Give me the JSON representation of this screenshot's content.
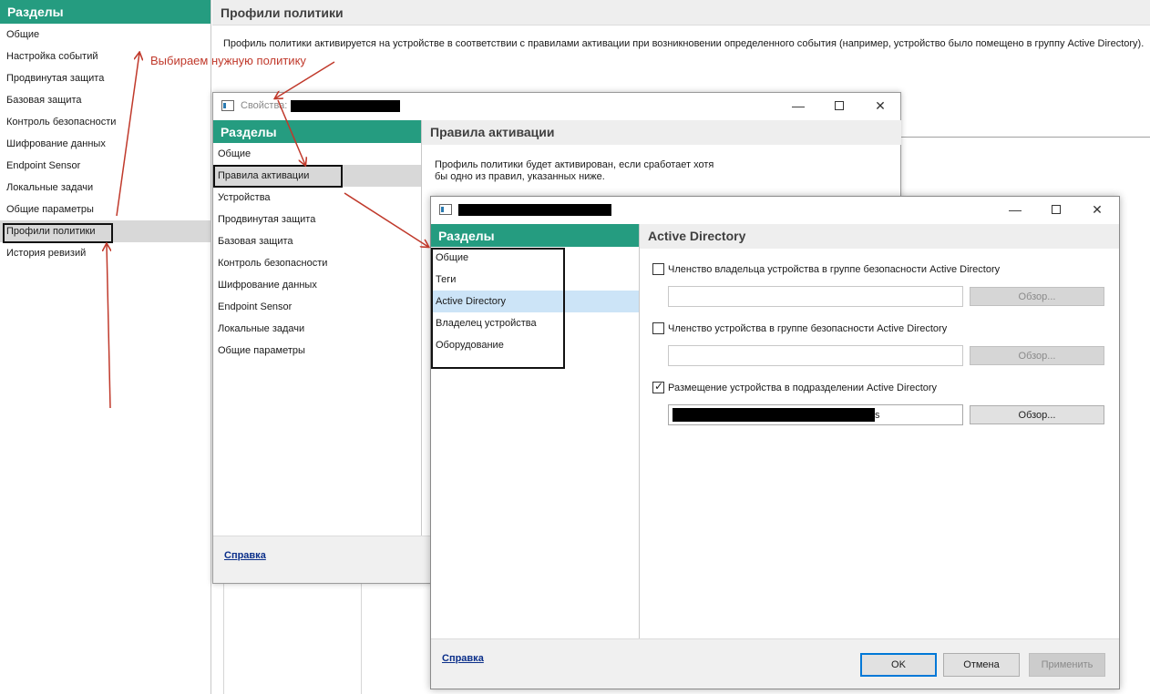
{
  "background": {
    "sidebar": {
      "header": "Разделы",
      "items": [
        "Общие",
        "Настройка событий",
        "Продвинутая защита",
        "Базовая защита",
        "Контроль безопасности",
        "Шифрование данных",
        "Endpoint Sensor",
        "Локальные задачи",
        "Общие параметры",
        "Профили политики",
        "История ревизий"
      ],
      "selected": "Профили политики"
    },
    "main": {
      "title": "Профили политики",
      "description": "Профиль политики активируется на устройстве в соответствии с правилами активации при возникновении определенного события (например, устройство было помещено в группу Active Directory)."
    }
  },
  "dialog1": {
    "title_prefix": "Свойства:",
    "sidebar": {
      "header": "Разделы",
      "items": [
        "Общие",
        "Правила активации",
        "Устройства",
        "Продвинутая защита",
        "Базовая защита",
        "Контроль безопасности",
        "Шифрование данных",
        "Endpoint Sensor",
        "Локальные задачи",
        "Общие параметры"
      ],
      "selected": "Правила активации"
    },
    "content": {
      "title": "Правила активации",
      "description": "Профиль политики будет активирован, если сработает хотя бы одно из правил, указанных ниже."
    },
    "footer": {
      "help": "Справка"
    }
  },
  "dialog2": {
    "sidebar": {
      "header": "Разделы",
      "items": [
        "Общие",
        "Теги",
        "Active Directory",
        "Владелец устройства",
        "Оборудование"
      ],
      "selected": "Active Directory"
    },
    "content": {
      "title": "Active Directory",
      "rules": [
        {
          "label": "Членство владельца устройства в группе безопасности Active Directory",
          "checked": false,
          "value": "",
          "browse": "Обзор...",
          "enabled": false
        },
        {
          "label": "Членство устройства в группе безопасности Active Directory",
          "checked": false,
          "value": "",
          "browse": "Обзор...",
          "enabled": false
        },
        {
          "label": "Размещение устройства в подразделении Active Directory",
          "checked": true,
          "value": "s",
          "browse": "Обзор...",
          "enabled": true
        }
      ]
    },
    "footer": {
      "help": "Справка",
      "ok": "OK",
      "cancel": "Отмена",
      "apply": "Применить"
    }
  },
  "annotation": {
    "text": "Выбираем нужную политику",
    "color": "#c0392b"
  },
  "colors": {
    "accent": "#259c80",
    "selection_grey": "#d8d8d8",
    "selection_blue": "#cce4f7"
  }
}
